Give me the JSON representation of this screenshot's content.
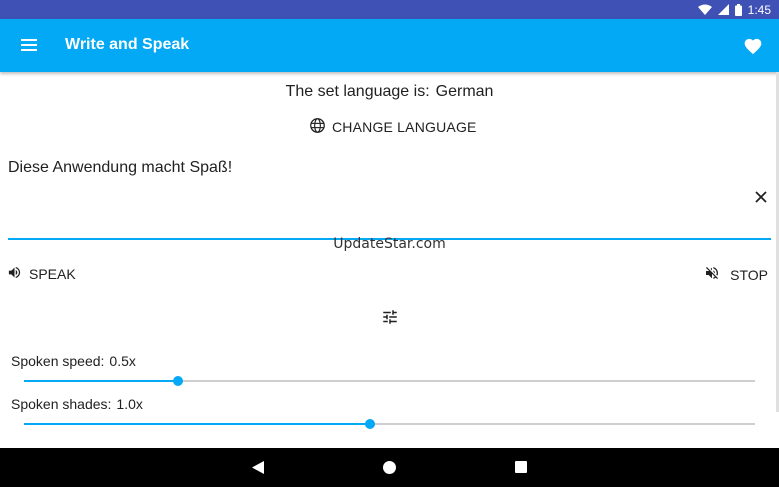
{
  "status_bar": {
    "time": "1:45",
    "icons": [
      "wifi-icon",
      "signal-icon",
      "battery-icon"
    ]
  },
  "app_bar": {
    "title": "Write and Speak",
    "icons": [
      "menu-icon",
      "heart-icon"
    ]
  },
  "language": {
    "label": "The set language is:",
    "value": "German",
    "change_button": "CHANGE LANGUAGE",
    "change_icon": "globe-icon"
  },
  "text_input": {
    "value": "Diese Anwendung macht Spaß!",
    "clear_icon": "close-icon"
  },
  "watermark": "UpdateStar.com",
  "controls": {
    "speak_label": "SPEAK",
    "speak_icon": "volume-up-icon",
    "stop_label": "STOP",
    "stop_icon": "volume-off-icon",
    "settings_icon": "tune-icon"
  },
  "sliders": [
    {
      "label": "Spoken speed:",
      "value_text": "0.5x",
      "fraction": 0.21
    },
    {
      "label": "Spoken shades:",
      "value_text": "1.0x",
      "fraction": 0.474
    }
  ],
  "nav_bar": {
    "icons": [
      "back-icon",
      "home-icon",
      "recent-apps-icon"
    ]
  },
  "colors": {
    "status_bar": "#3f51b5",
    "app_bar": "#03a9f4",
    "accent": "#03a9f4",
    "nav_bar": "#000000"
  }
}
